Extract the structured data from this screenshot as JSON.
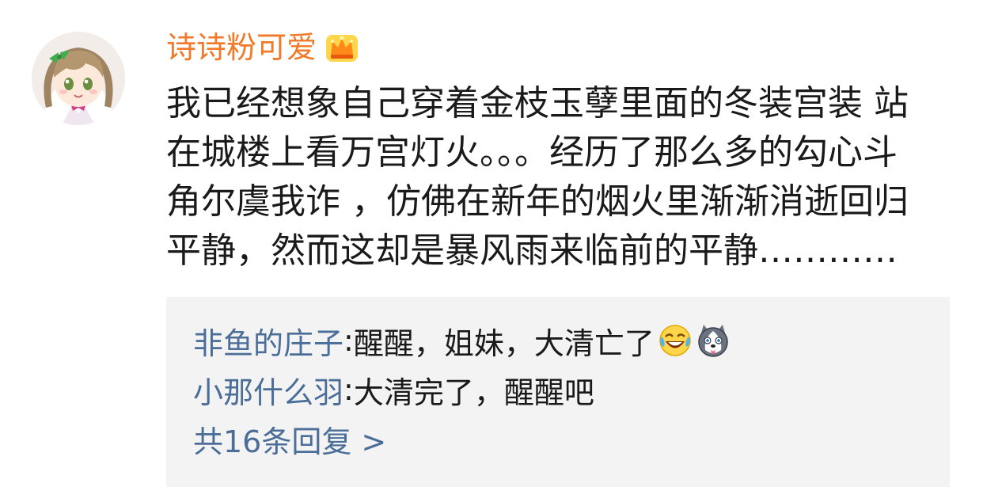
{
  "comment": {
    "username": "诗诗粉可爱",
    "badge_icon": "crown-badge-icon",
    "username_color": "#f07a2a",
    "text_lines": [
      "我已经想象自己穿着金枝玉孽里面的冬装宫装 站",
      "在城楼上看万宫灯火。。。经历了那么多的勾心斗",
      "角尔虞我诈 ，仿佛在新年的烟火里渐渐消逝回归",
      "平静，然而这却是暴风雨来临前的平静…………"
    ]
  },
  "replies": {
    "items": [
      {
        "name": "非鱼的庄子",
        "colon": ":",
        "text": " 醒醒，姐妹，大清亡了",
        "emojis": [
          "laughing-tears-emoji-icon",
          "husky-dog-emoji-icon"
        ]
      },
      {
        "name": "小那什么羽",
        "colon": ":",
        "text": " 大清完了，醒醒吧",
        "emojis": []
      }
    ],
    "more_label": "共16条回复 >",
    "link_color": "#4a6e98"
  }
}
